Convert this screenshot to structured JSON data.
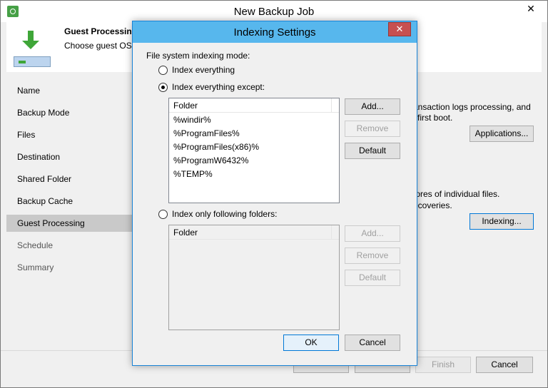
{
  "main_window": {
    "title": "New Backup Job",
    "close_glyph": "✕",
    "header": {
      "step_title": "Guest Processing",
      "step_description": "Choose guest OS p"
    },
    "nav_items": [
      {
        "label": "Name",
        "state": "normal"
      },
      {
        "label": "Backup Mode",
        "state": "normal"
      },
      {
        "label": "Files",
        "state": "normal"
      },
      {
        "label": "Destination",
        "state": "normal"
      },
      {
        "label": "Shared Folder",
        "state": "normal"
      },
      {
        "label": "Backup Cache",
        "state": "normal"
      },
      {
        "label": "Guest Processing",
        "state": "active"
      },
      {
        "label": "Schedule",
        "state": "disabled"
      },
      {
        "label": "Summary",
        "state": "disabled"
      }
    ],
    "background_text": {
      "transaction_line1": "ansaction logs processing, and",
      "transaction_line2": "first boot.",
      "restore_line1": "tores of individual files.",
      "restore_line2": "ecoveries."
    },
    "buttons": {
      "applications": "Applications...",
      "indexing": "Indexing...",
      "finish": "Finish",
      "cancel": "Cancel"
    }
  },
  "dialog": {
    "title": "Indexing Settings",
    "close_glyph": "✕",
    "mode_label": "File system indexing mode:",
    "options": {
      "index_everything": "Index everything",
      "index_except": "Index everything except:",
      "index_only": "Index only following folders:"
    },
    "selected_option": "index_except",
    "except_list": {
      "column_header": "Folder",
      "rows": [
        "%windir%",
        "%ProgramFiles%",
        "%ProgramFiles(x86)%",
        "%ProgramW6432%",
        "%TEMP%"
      ]
    },
    "only_list": {
      "column_header": "Folder",
      "rows": []
    },
    "except_buttons": {
      "add": "Add...",
      "remove": "Remove",
      "default": "Default"
    },
    "only_buttons": {
      "add": "Add...",
      "remove": "Remove",
      "default": "Default"
    },
    "ok": "OK",
    "cancel": "Cancel"
  }
}
